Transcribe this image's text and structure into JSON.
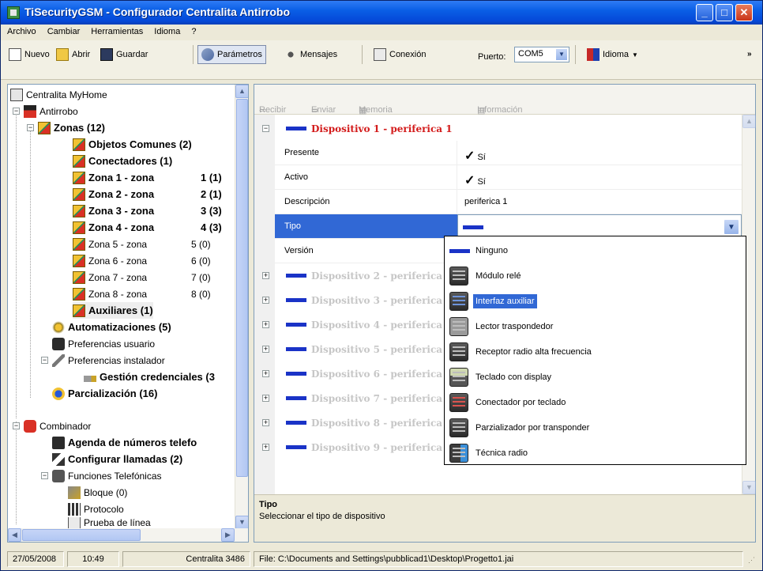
{
  "window": {
    "title": "TiSecurityGSM - Configurador Centralita Antirrobo"
  },
  "menu": [
    "Archivo",
    "Cambiar",
    "Herramientas",
    "Idioma",
    "?"
  ],
  "toolbar": {
    "nuevo": "Nuevo",
    "abrir": "Abrir",
    "guardar": "Guardar",
    "parametros": "Parámetros",
    "mensajes": "Mensajes",
    "conexion": "Conexión",
    "puerto_label": "Puerto:",
    "puerto_value": "COM5",
    "idioma": "Idioma"
  },
  "tree": {
    "root": "Centralita MyHome",
    "antirrobo": "Antirrobo",
    "zonas": "Zonas (12)",
    "objetos": "Objetos Comunes (2)",
    "conectadores": "Conectadores (1)",
    "zonas_list": [
      {
        "label": "Zona 1 - zona",
        "num": "1 (1)"
      },
      {
        "label": "Zona 2 - zona",
        "num": "2 (1)"
      },
      {
        "label": "Zona 3 - zona",
        "num": "3 (3)"
      },
      {
        "label": "Zona 4 - zona",
        "num": "4 (3)"
      },
      {
        "label": "Zona 5 - zona",
        "num": "5 (0)"
      },
      {
        "label": "Zona 6 - zona",
        "num": "6 (0)"
      },
      {
        "label": "Zona 7 - zona",
        "num": "7 (0)"
      },
      {
        "label": "Zona 8 - zona",
        "num": "8 (0)"
      }
    ],
    "auxiliares": "Auxiliares (1)",
    "automatizaciones": "Automatizaciones (5)",
    "pref_usuario": "Preferencias usuario",
    "pref_instalador": "Preferencias instalador",
    "gestion": "Gestión credenciales (3",
    "parcializacion": "Parcialización (16)",
    "combinador": "Combinador",
    "agenda": "Agenda de números telefo",
    "configurar": "Configurar llamadas (2)",
    "funciones": "Funciones Telefónicas",
    "bloque": "Bloque (0)",
    "protocolo": "Protocolo",
    "prueba": "Prueba de línea"
  },
  "right_toolbar": {
    "recibir": "Recibir",
    "enviar": "Enviar",
    "memoria": "Memoria de sucesos",
    "informacion": "Información"
  },
  "grid": {
    "header": "Dispositivo 1 - periferica  1",
    "props": [
      {
        "key": "Presente",
        "value": "Sí",
        "check": "✓"
      },
      {
        "key": "Activo",
        "value": "Sí",
        "check": "✓"
      },
      {
        "key": "Descripción",
        "value": "periferica  1",
        "check": ""
      },
      {
        "key": "Tipo",
        "value": "Ninguno",
        "check": ""
      },
      {
        "key": "Versión",
        "value": "",
        "check": ""
      }
    ],
    "collapsed": [
      "Dispositivo 2 - periferica",
      "Dispositivo 3 - periferica",
      "Dispositivo 4 - periferica",
      "Dispositivo 5 - periferica",
      "Dispositivo 6 - periferica",
      "Dispositivo 7 - periferica",
      "Dispositivo 8 - periferica",
      "Dispositivo 9 - periferica"
    ]
  },
  "dropdown": {
    "items": [
      "Ninguno",
      "Módulo relé",
      "Interfaz auxiliar",
      "Lector traspondedor",
      "Receptor radio alta frecuencia",
      "Teclado con display",
      "Conectador por teclado",
      "Parzializador por transponder",
      "Técnica radio"
    ],
    "selected": "Interfaz auxiliar"
  },
  "description": {
    "title": "Tipo",
    "text": "Seleccionar el tipo de dispositivo"
  },
  "status": {
    "date": "27/05/2008",
    "time": "10:49",
    "centralita": "Centralita 3486",
    "file": "File: C:\\Documents and Settings\\pubblicad1\\Desktop\\Progetto1.jai"
  },
  "colors": {
    "title_blue": "#0548d8",
    "selection": "#3168d5",
    "device_red": "#d31b1b",
    "device_dash": "#1a33c7"
  }
}
